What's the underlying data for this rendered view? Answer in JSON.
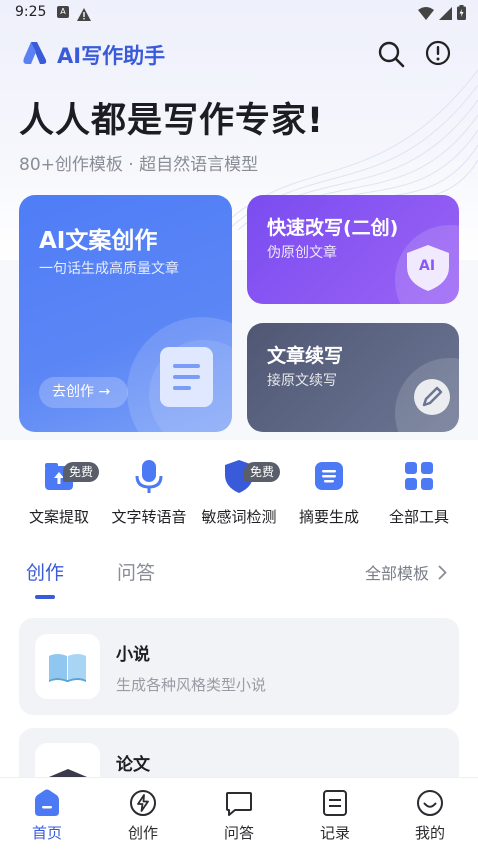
{
  "status_bar": {
    "time": "9:25",
    "left_icons": [
      "A",
      "!"
    ]
  },
  "header": {
    "app_title": "AI写作助手"
  },
  "hero": {
    "headline": "人人都是写作专家!",
    "subline": "80+创作模板 · 超自然语言模型"
  },
  "cards": {
    "main": {
      "title": "AI文案创作",
      "subtitle": "一句话生成高质量文章",
      "button": "去创作 →"
    },
    "rewrite": {
      "title": "快速改写(二创)",
      "subtitle": "伪原创文章",
      "badge": "AI"
    },
    "continue": {
      "title": "文章续写",
      "subtitle": "接原文续写"
    }
  },
  "tools": [
    {
      "label": "文案提取",
      "badge": "免费"
    },
    {
      "label": "文字转语音",
      "badge": ""
    },
    {
      "label": "敏感词检测",
      "badge": "免费"
    },
    {
      "label": "摘要生成",
      "badge": ""
    },
    {
      "label": "全部工具",
      "badge": ""
    }
  ],
  "tabs": {
    "active": "创作",
    "inactive": "问答",
    "all_templates": "全部模板"
  },
  "templates": [
    {
      "title": "小说",
      "subtitle": "生成各种风格类型小说",
      "icon": "book-icon"
    },
    {
      "title": "论文",
      "subtitle": "",
      "icon": "graduation-cap-icon"
    }
  ],
  "bottom_nav": [
    {
      "label": "首页",
      "icon": "home-icon",
      "active": true
    },
    {
      "label": "创作",
      "icon": "create-icon",
      "active": false
    },
    {
      "label": "问答",
      "icon": "chat-icon",
      "active": false
    },
    {
      "label": "记录",
      "icon": "record-icon",
      "active": false
    },
    {
      "label": "我的",
      "icon": "profile-icon",
      "active": false
    }
  ],
  "colors": {
    "accent": "#3a5bd9",
    "card_blue": "#4f7df7",
    "card_purple": "#8a58f3",
    "card_slate": "#5a6380"
  }
}
